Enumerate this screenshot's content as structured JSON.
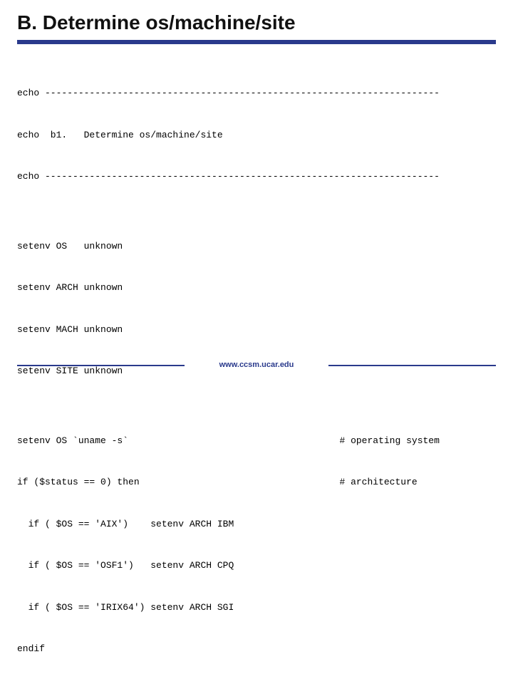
{
  "title": "B. Determine os/machine/site",
  "code_lines": [
    "echo -----------------------------------------------------------------------",
    "echo  b1.   Determine os/machine/site",
    "echo -----------------------------------------------------------------------",
    "",
    "setenv OS   unknown",
    "setenv ARCH unknown",
    "setenv MACH unknown",
    "setenv SITE unknown",
    "",
    "setenv OS `uname -s`                                      # operating system",
    "if ($status == 0) then                                    # architecture",
    "  if ( $OS == 'AIX')    setenv ARCH IBM",
    "  if ( $OS == 'OSF1')   setenv ARCH CPQ",
    "  if ( $OS == 'IRIX64') setenv ARCH SGI",
    "endif"
  ],
  "footer": "www.ccsm.ucar.edu"
}
